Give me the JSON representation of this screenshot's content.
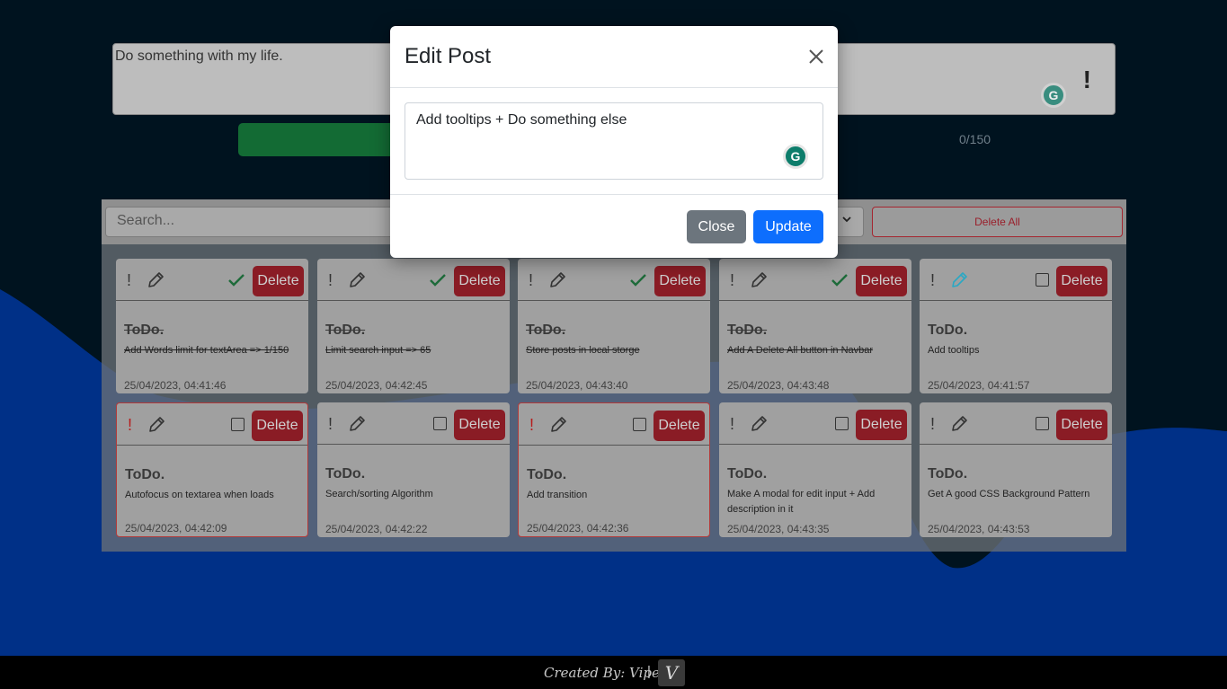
{
  "composer": {
    "value": "Do something with my life.",
    "counter": "0/150"
  },
  "toolbar": {
    "search_placeholder": "Search...",
    "delete_all_label": "Delete All"
  },
  "cards": [
    {
      "title": "ToDo.",
      "text": "Add Words limit for textArea => 1/150",
      "date": "25/04/2023, 04:41:46",
      "delete_label": "Delete",
      "done": true,
      "urgent": false,
      "active_edit": false
    },
    {
      "title": "ToDo.",
      "text": "Limit search input => 65",
      "date": "25/04/2023, 04:42:45",
      "delete_label": "Delete",
      "done": true,
      "urgent": false,
      "active_edit": false
    },
    {
      "title": "ToDo.",
      "text": "Store posts in local storge",
      "date": "25/04/2023, 04:43:40",
      "delete_label": "Delete",
      "done": true,
      "urgent": false,
      "active_edit": false
    },
    {
      "title": "ToDo.",
      "text": "Add A Delete All button in Navbar",
      "date": "25/04/2023, 04:43:48",
      "delete_label": "Delete",
      "done": true,
      "urgent": false,
      "active_edit": false
    },
    {
      "title": "ToDo.",
      "text": "Add tooltips",
      "date": "25/04/2023, 04:41:57",
      "delete_label": "Delete",
      "done": false,
      "urgent": false,
      "active_edit": true
    },
    {
      "title": "ToDo.",
      "text": "Autofocus on textarea when loads",
      "date": "25/04/2023, 04:42:09",
      "delete_label": "Delete",
      "done": false,
      "urgent": true,
      "active_edit": false
    },
    {
      "title": "ToDo.",
      "text": "Search/sorting Algorithm",
      "date": "25/04/2023, 04:42:22",
      "delete_label": "Delete",
      "done": false,
      "urgent": false,
      "active_edit": false
    },
    {
      "title": "ToDo.",
      "text": "Add transition",
      "date": "25/04/2023, 04:42:36",
      "delete_label": "Delete",
      "done": false,
      "urgent": true,
      "active_edit": false
    },
    {
      "title": "ToDo.",
      "text": "Make A modal for edit input + Add description in it",
      "date": "25/04/2023, 04:43:35",
      "delete_label": "Delete",
      "done": false,
      "urgent": false,
      "active_edit": false
    },
    {
      "title": "ToDo.",
      "text": "Get A good CSS Background Pattern",
      "date": "25/04/2023, 04:43:53",
      "delete_label": "Delete",
      "done": false,
      "urgent": false,
      "active_edit": false
    }
  ],
  "modal": {
    "title": "Edit Post",
    "textarea_value": "Add tooltips + Do something else",
    "close_label": "Close",
    "update_label": "Update"
  },
  "footer": {
    "credit": "Created By:  Viper",
    "separator": "|",
    "logo_letter": "V"
  },
  "colors": {
    "background": "#00131f",
    "wave": "#003087",
    "primary": "#0d6efd",
    "secondary": "#6c757d",
    "danger": "#8a1c25",
    "done_check": "#1e6b3a",
    "edit_active": "#2aa8c4"
  }
}
